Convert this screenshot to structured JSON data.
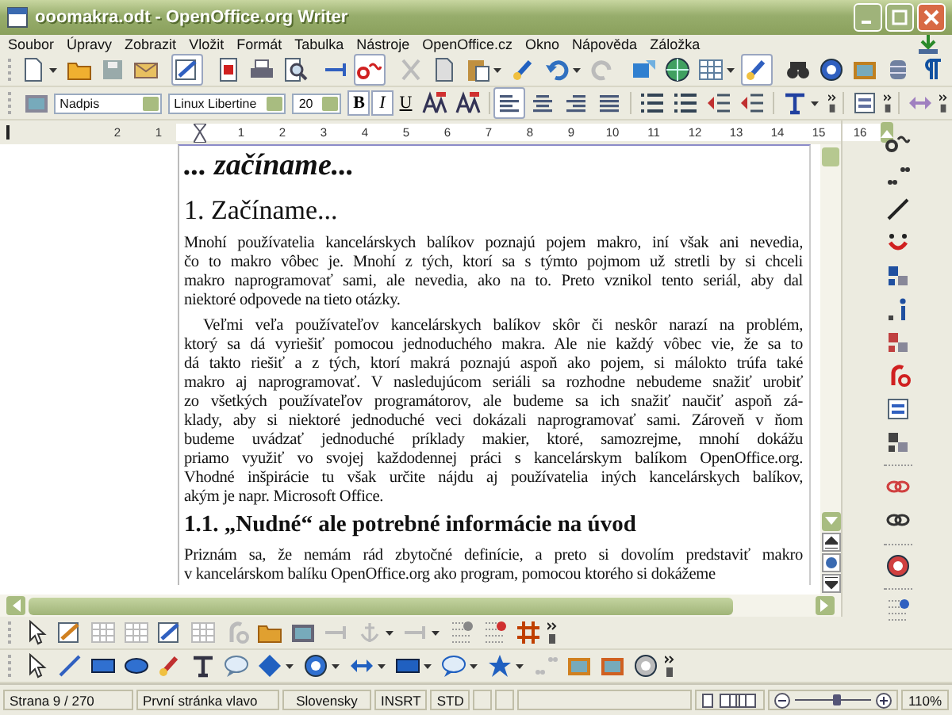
{
  "window": {
    "title": "ooomakra.odt - OpenOffice.org Writer"
  },
  "menu": [
    "Soubor",
    "Úpravy",
    "Zobrazit",
    "Vložit",
    "Formát",
    "Tabulka",
    "Nástroje",
    "OpenOffice.cz",
    "Okno",
    "Nápověda",
    "Záložka"
  ],
  "standard_toolbar": {
    "edit_mode_on": true,
    "autospell_on": true,
    "draw_functions_on": true
  },
  "formatting_toolbar": {
    "style": "Nadpis",
    "font": "Linux Libertine",
    "size": "20",
    "format_buttons": [
      {
        "label": "B",
        "kind": "bold",
        "selected": true
      },
      {
        "label": "I",
        "kind": "italic",
        "selected": true
      },
      {
        "label": "U",
        "kind": "underline",
        "selected": false
      }
    ],
    "alignment": [
      {
        "kind": "left",
        "selected": true
      },
      {
        "kind": "center",
        "selected": false
      },
      {
        "kind": "right",
        "selected": false
      },
      {
        "kind": "justify",
        "selected": false
      }
    ]
  },
  "ruler": {
    "left_labels": [
      "2",
      "1"
    ],
    "right_labels": [
      "1",
      "2",
      "3",
      "4",
      "5",
      "6",
      "7",
      "8",
      "9",
      "10",
      "11",
      "12",
      "13",
      "14",
      "15",
      "16"
    ]
  },
  "document": [
    {
      "kind": "title",
      "text": "... začíname..."
    },
    {
      "kind": "heading1",
      "text": "1. Začíname..."
    },
    {
      "kind": "paragraph",
      "indent": false,
      "lines": [
        "Mnohí používatelia kancelárskych balíkov poznajú pojem makro, iní však ani nevedia,",
        "čo to makro vôbec je. Mnohí z tých, ktorí sa s týmto pojmom už stretli by si chceli",
        "makro naprogramovať sami, ale nevedia, ako na to. Preto vznikol tento seriál, aby dal",
        "niektoré odpovede na tieto otázky."
      ]
    },
    {
      "kind": "paragraph",
      "indent": true,
      "lines": [
        "Veľmi veľa používateľov kancelárskych balíkov skôr či neskôr narazí na problém,",
        "ktorý sa dá vyriešiť pomocou jednoduchého makra. Ale nie každý vôbec vie, že sa to",
        "dá takto riešiť a z tých, ktorí makrá poznajú aspoň ako pojem, si málokto trúfa také",
        "makro aj naprogramovať. V nasledujúcom seriáli sa rozhodne nebudeme snažiť urobiť",
        "zo všetkých používateľov programátorov, ale budeme sa ich snažiť naučiť aspoň zá-",
        "klady, aby si niektoré jednoduché veci dokázali naprogramovať sami. Zároveň v ňom",
        "budeme uvádzať jednoduché príklady makier, ktoré, samozrejme, mnohí dokážu",
        "priamo využiť vo svojej každodennej práci s kancelárskym balíkom OpenOffice.org.",
        "Vhodné inšpirácie tu však určite nájdu aj používatelia iných kancelárskych balíkov,",
        "akým je napr. Microsoft Office."
      ]
    },
    {
      "kind": "heading2",
      "text": "1.1. „Nudné“ ale potrebné informácie na úvod"
    },
    {
      "kind": "paragraph",
      "indent": false,
      "lines": [
        "Priznám sa, že nemám rád zbytočné definície, a preto si dovolím predstaviť makro",
        "v kancelárskom balíku OpenOffice.org ako program, pomocou ktorého si dokážeme"
      ]
    }
  ],
  "status_bar": {
    "page": "Strana 9 / 270",
    "page_style": "První stránka vlavo",
    "language": "Slovensky",
    "insert_mode": "INSRT",
    "selection_mode": "STD",
    "zoom": "110%",
    "zoom_slider": {
      "level": 0.55
    }
  }
}
